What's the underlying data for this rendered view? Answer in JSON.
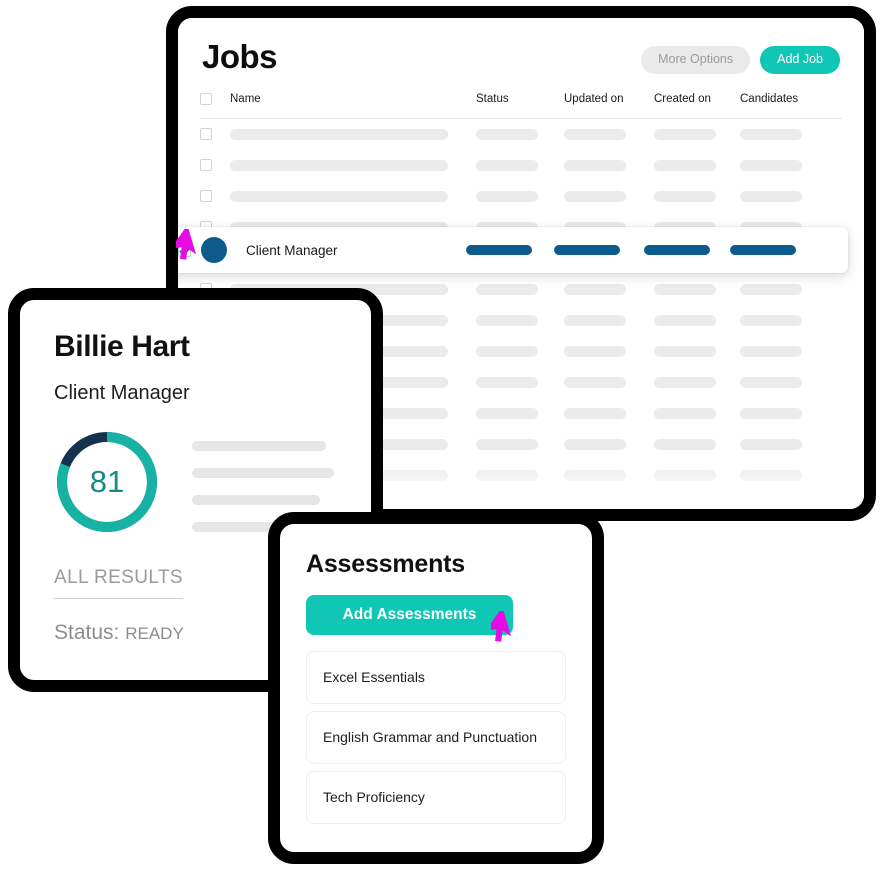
{
  "jobs": {
    "title": "Jobs",
    "more_options_label": "More Options",
    "add_job_label": "Add Job",
    "columns": {
      "name": "Name",
      "status": "Status",
      "updated_on": "Updated on",
      "created_on": "Created on",
      "candidates": "Candidates"
    },
    "rows_above_selected": 3,
    "rows_below_selected": 8,
    "selected_row": {
      "name": "Client Manager",
      "checked": true,
      "avatar_color": "#0d5b8c",
      "pill_color": "#0d5b8c"
    }
  },
  "profile": {
    "name": "Billie Hart",
    "role": "Client Manager",
    "score": "81",
    "score_percent": 81,
    "score_color": "#16b2a4",
    "score_remainder_color": "#14314d",
    "all_results_label": "ALL RESULTS",
    "status_label": "Status:",
    "status_value": "READY",
    "skeleton_lines": 4
  },
  "assessments": {
    "title": "Assessments",
    "add_button_label": "Add Assessments",
    "items": [
      "Excel Essentials",
      "English Grammar and Punctuation",
      "Tech Proficiency"
    ]
  },
  "cursors": {
    "row_cursor": "mouse-pointer-icon",
    "assessments_cursor": "mouse-pointer-icon",
    "color": "#e60ae6"
  },
  "theme": {
    "accent": "#10c6b4",
    "navy": "#0d5b8c",
    "frame": "#000000",
    "skeleton": "#ebebeb"
  }
}
